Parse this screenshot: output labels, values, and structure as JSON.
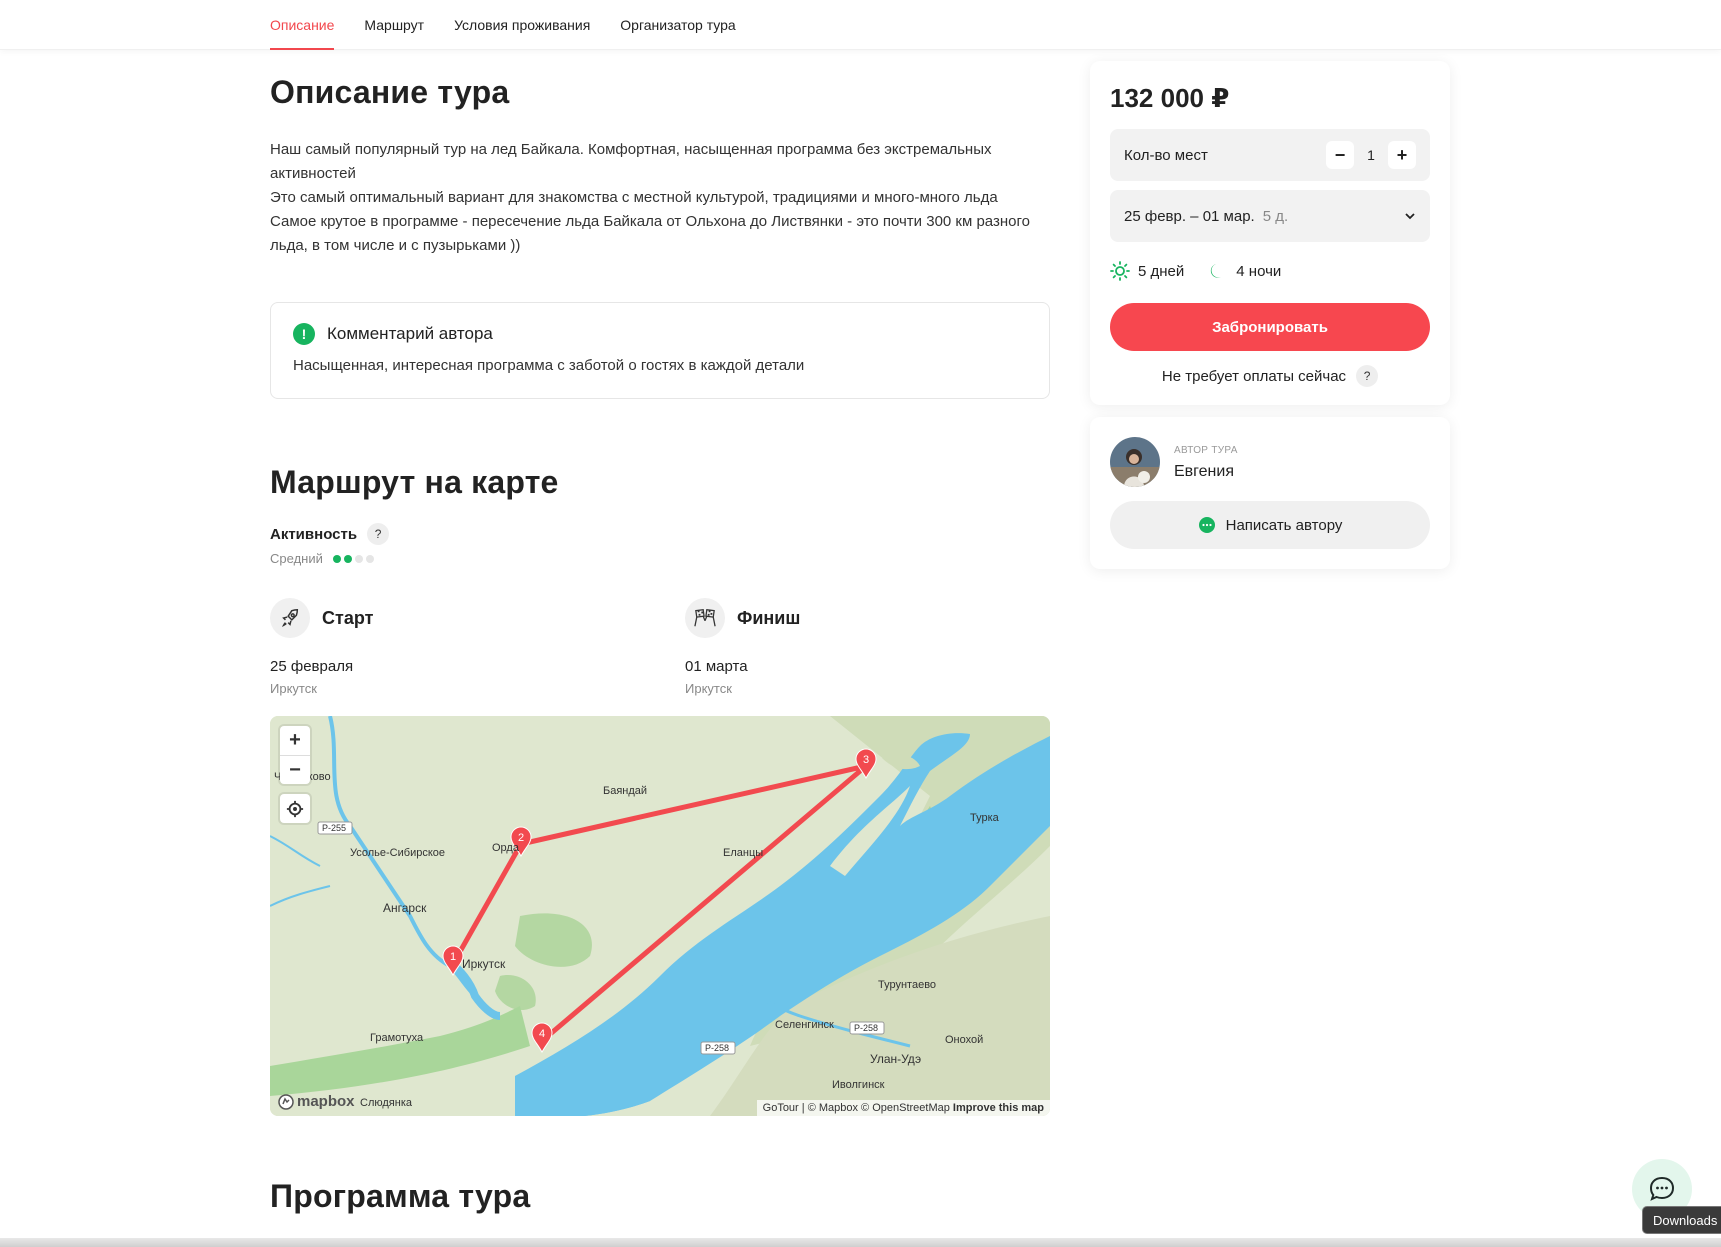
{
  "nav": {
    "tabs": [
      {
        "label": "Описание",
        "active": true
      },
      {
        "label": "Маршрут",
        "active": false
      },
      {
        "label": "Условия проживания",
        "active": false
      },
      {
        "label": "Организатор тура",
        "active": false
      }
    ]
  },
  "description": {
    "title": "Описание тура",
    "paragraphs": [
      "Наш самый популярный тур на лед Байкала. Комфортная, насыщенная программа без экстремальных активностей",
      "Это самый оптимальный вариант для знакомства с местной культурой, традициями и много-много льда",
      "Самое крутое в программе - пересечение льда Байкала от Ольхона до Листвянки - это почти 300 км разного льда, в том числе и с пузырьками ))"
    ],
    "comment": {
      "title": "Комментарий автора",
      "text": "Насыщенная, интересная программа с заботой о гостях в каждой детали"
    }
  },
  "route": {
    "title": "Маршрут на карте",
    "activity_label": "Активность",
    "activity_level": "Средний",
    "activity_rating": {
      "value": 2,
      "max": 4
    },
    "start": {
      "title": "Старт",
      "date": "25 февраля",
      "city": "Иркутск"
    },
    "finish": {
      "title": "Финиш",
      "date": "01 марта",
      "city": "Иркутск"
    },
    "map": {
      "places": [
        "Баяндай",
        "Турка",
        "Усолье-Сибирское",
        "Еланцы",
        "Ангарск",
        "Иркутск",
        "Турунтаево",
        "Грамотуха",
        "Селенгинск",
        "Онохой",
        "Улан-Удэ",
        "Иволгинск",
        "Слюдянка",
        "Орда",
        "Черемхово"
      ],
      "roads": [
        "Р-255",
        "Р-258",
        "Р-258"
      ],
      "markers": [
        "1",
        "2",
        "3",
        "4"
      ],
      "logo": "mapbox",
      "attribution": {
        "gotour": "GoTour",
        "rest": " | © Mapbox © OpenStreetMap ",
        "improve": "Improve this map"
      },
      "water_color": "#6cc4ea",
      "land_color": "#dfe7cf",
      "route_color": "#f24a4f"
    }
  },
  "program": {
    "title": "Программа тура"
  },
  "booking": {
    "price": "132 000 ₽",
    "seats_label": "Кол-во мест",
    "seats_value": "1",
    "dates_range": "25 февр. – 01 мар.",
    "dates_days": "5 д.",
    "days_text": "5 дней",
    "nights_text": "4 ночи",
    "book_label": "Забронировать",
    "no_payment": "Не требует оплаты сейчас",
    "accent_color": "#f7474f"
  },
  "author": {
    "caption": "АВТОР ТУРА",
    "name": "Евгения",
    "write_label": "Написать автору"
  },
  "downloads_tip": "Downloads"
}
